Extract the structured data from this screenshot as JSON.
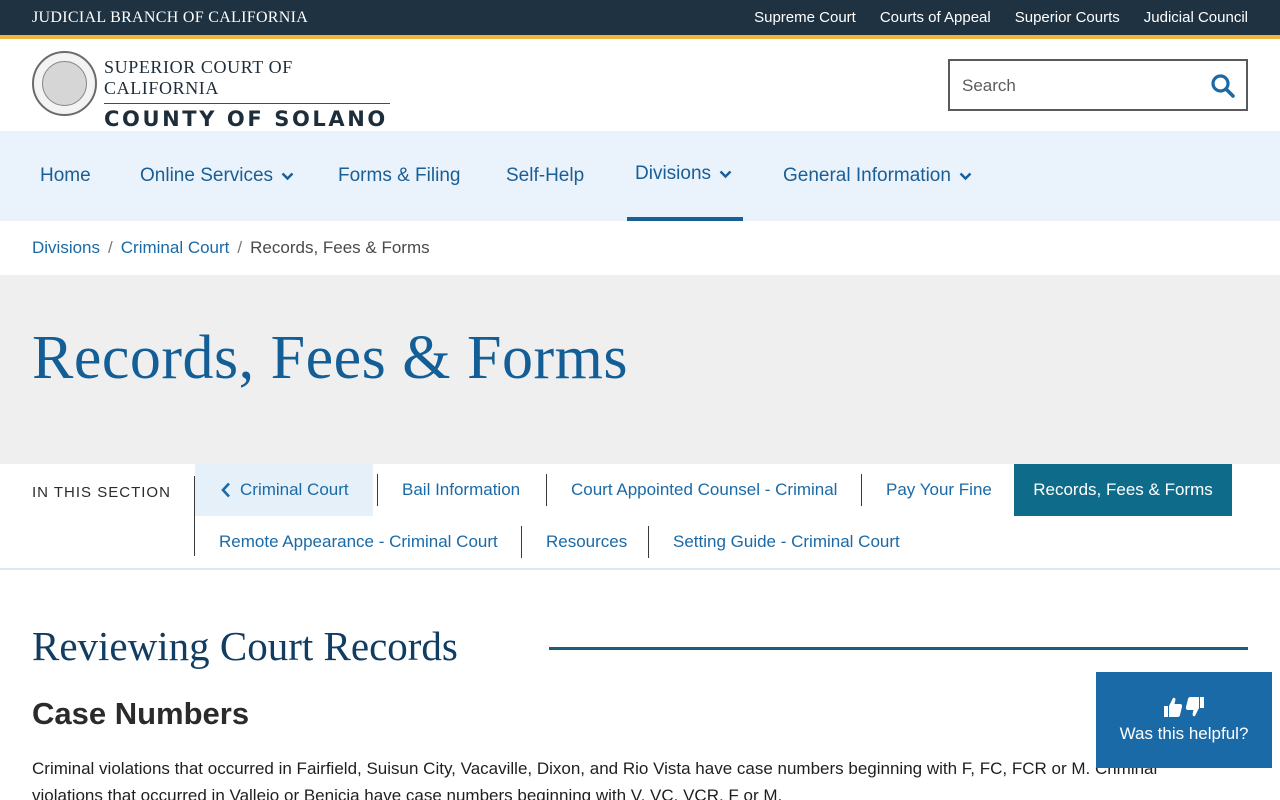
{
  "topbar": {
    "branch": "JUDICIAL BRANCH OF CALIFORNIA",
    "links": [
      "Supreme Court",
      "Courts of Appeal",
      "Superior Courts",
      "Judicial Council"
    ]
  },
  "header": {
    "brand_top": "SUPERIOR COURT OF CALIFORNIA",
    "brand_bottom": "COUNTY OF SOLANO",
    "search_placeholder": "Search"
  },
  "nav": {
    "items": [
      {
        "label": "Home",
        "has_dropdown": false
      },
      {
        "label": "Online Services",
        "has_dropdown": true
      },
      {
        "label": "Forms & Filing",
        "has_dropdown": false
      },
      {
        "label": "Self-Help",
        "has_dropdown": false
      },
      {
        "label": "Divisions",
        "has_dropdown": true,
        "active": true
      },
      {
        "label": "General Information",
        "has_dropdown": true
      }
    ]
  },
  "breadcrumb": {
    "items": [
      "Divisions",
      "Criminal Court"
    ],
    "current": "Records, Fees & Forms"
  },
  "hero": {
    "title": "Records, Fees & Forms"
  },
  "in_section": {
    "label": "IN THIS SECTION",
    "back_link": "Criminal Court",
    "row1": [
      "Bail Information",
      "Court Appointed Counsel - Criminal",
      "Pay Your Fine",
      "Records, Fees & Forms"
    ],
    "row2": [
      "Remote Appearance - Criminal Court",
      "Resources",
      "Setting Guide - Criminal Court"
    ],
    "active": "Records, Fees & Forms"
  },
  "content": {
    "heading": "Reviewing Court Records",
    "subheading": "Case Numbers",
    "paragraph": "Criminal violations that occurred in Fairfield, Suisun City, Vacaville, Dixon, and Rio Vista have case numbers beginning with F, FC, FCR or M. Criminal violations that occurred in Vallejo or Benicia have case numbers beginning with V, VC, VCR, F or M."
  },
  "feedback": {
    "label": "Was this helpful?"
  },
  "colors": {
    "topbar": "#1e3242",
    "accent": "#f0b43c",
    "link": "#1a6aa8",
    "nav_bg": "#eaf3fb",
    "active_tab": "#0f6b8a",
    "feedback_bg": "#1a6aa8"
  },
  "icons": {
    "search": "search-icon",
    "dropdown": "chevron-down-icon",
    "back": "chevron-left-icon",
    "feedback": "thumbs-up-down-icon",
    "seal": "court-seal-logo"
  }
}
